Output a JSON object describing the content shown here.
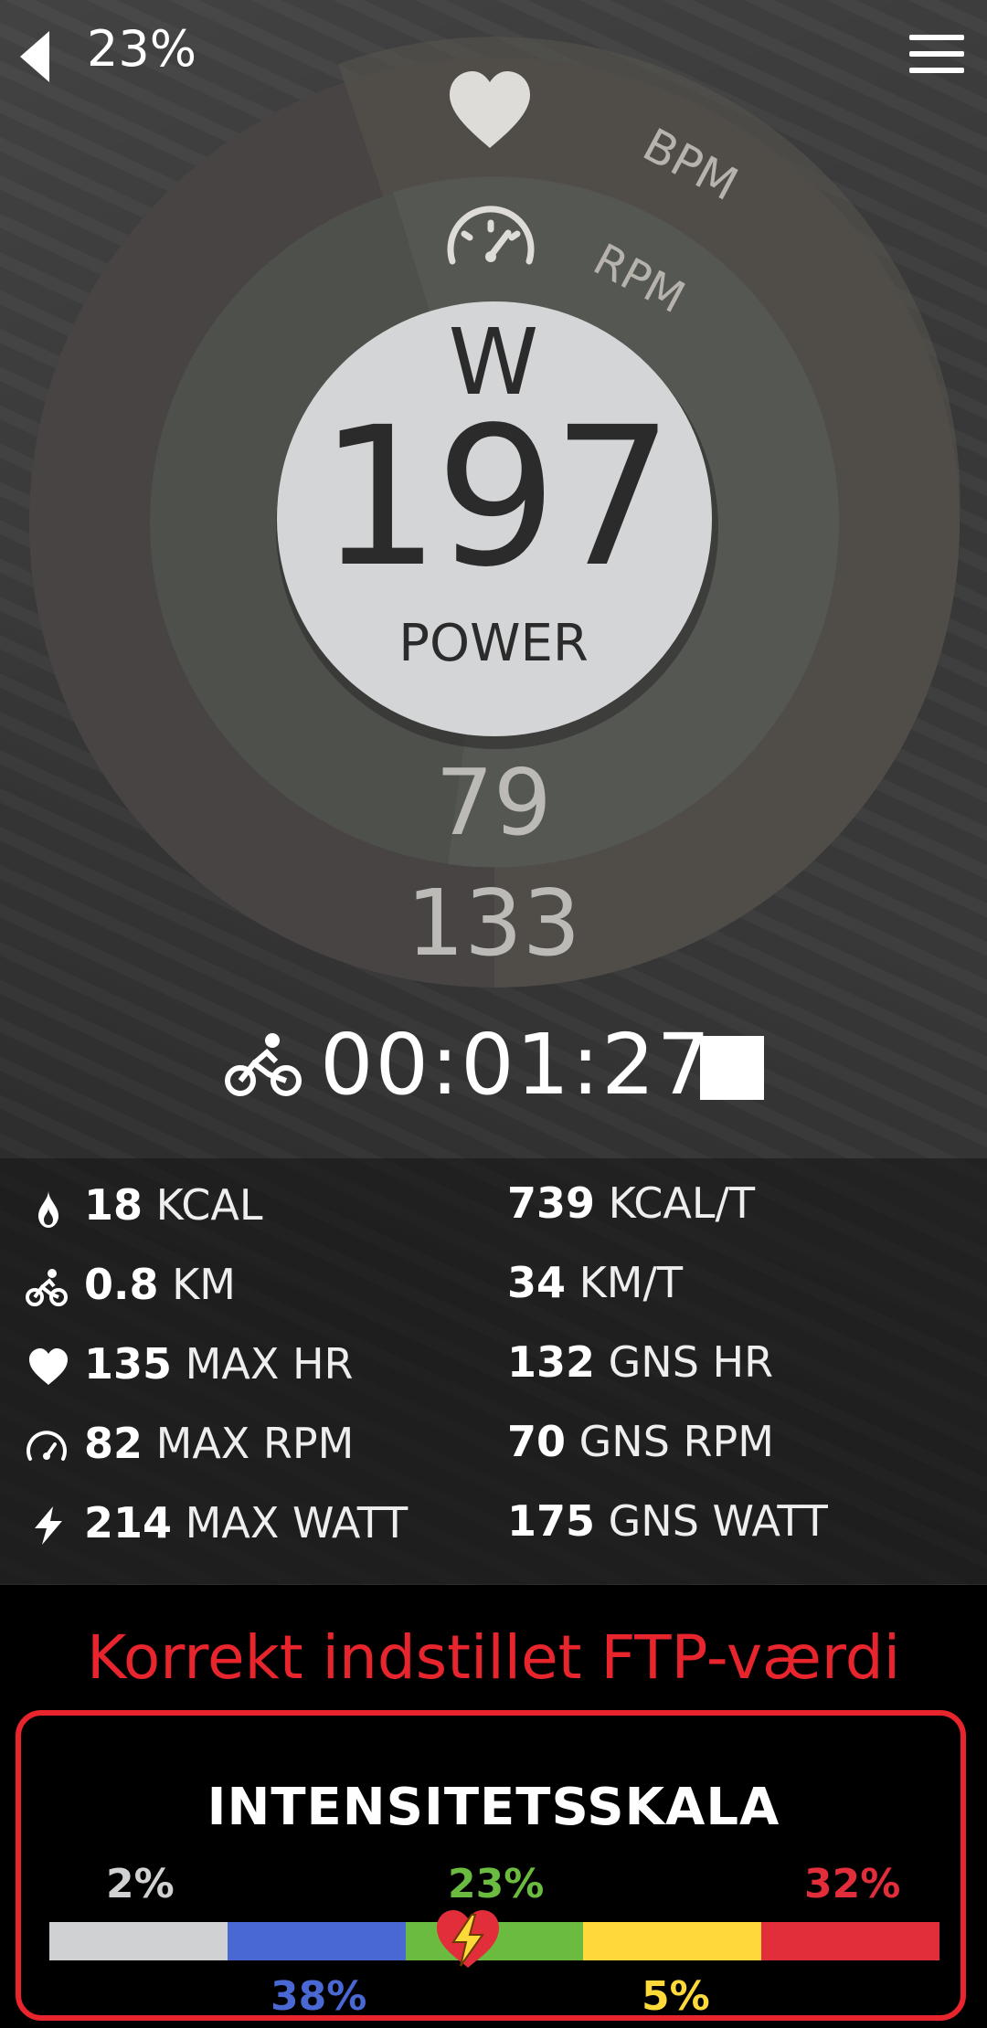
{
  "status": {
    "battery": "23%"
  },
  "dial": {
    "unit": "W",
    "power_value": "197",
    "power_label": "POWER",
    "rpm_value": "79",
    "bpm_value": "133",
    "bpm_label": "BPM",
    "rpm_label": "RPM"
  },
  "timer": {
    "elapsed": "00:01:27"
  },
  "stats": {
    "left": [
      {
        "icon": "flame-icon",
        "value": "18",
        "unit": "KCAL"
      },
      {
        "icon": "bike-icon",
        "value": "0.8",
        "unit": "KM"
      },
      {
        "icon": "heart-icon",
        "value": "135",
        "unit": "MAX HR"
      },
      {
        "icon": "speedometer-icon",
        "value": "82",
        "unit": "MAX RPM"
      },
      {
        "icon": "lightning-icon",
        "value": "214",
        "unit": "MAX WATT"
      }
    ],
    "right": [
      {
        "value": "739",
        "unit": "KCAL/T"
      },
      {
        "value": "34",
        "unit": "KM/T"
      },
      {
        "value": "132",
        "unit": "GNS HR"
      },
      {
        "value": "70",
        "unit": "GNS RPM"
      },
      {
        "value": "175",
        "unit": "GNS WATT"
      }
    ]
  },
  "ftp_message": "Korrekt indstillet FTP-værdi",
  "intensity": {
    "title": "INTENSITETSSKALA",
    "zones": [
      {
        "percent": "2%",
        "color": "#d0d1d3"
      },
      {
        "percent": "38%",
        "color": "#4a68d4"
      },
      {
        "percent": "23%",
        "color": "#6bbb40"
      },
      {
        "percent": "5%",
        "color": "#fdda3a"
      },
      {
        "percent": "32%",
        "color": "#e22d3a"
      }
    ]
  },
  "colors": {
    "accent_red": "#e8242d"
  }
}
